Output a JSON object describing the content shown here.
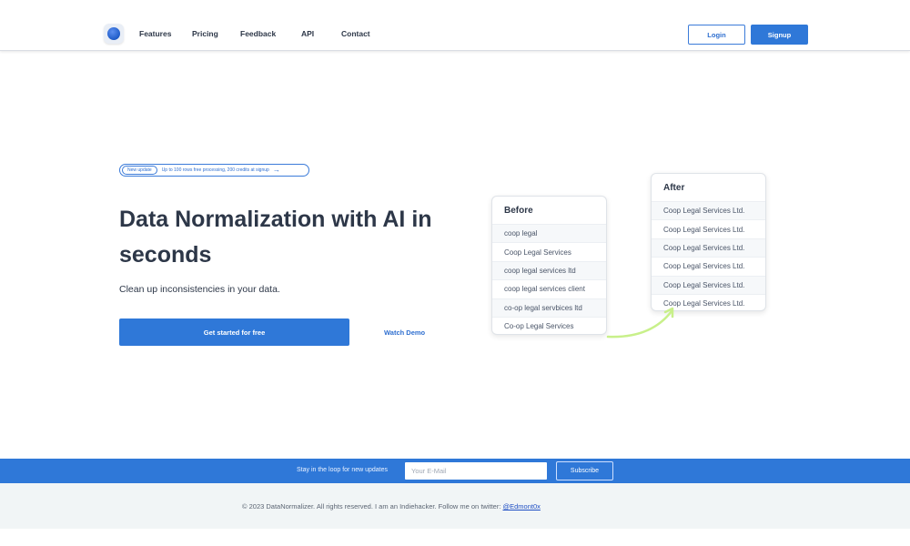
{
  "nav": {
    "links": [
      "Features",
      "Pricing",
      "Feedback",
      "API",
      "Contact"
    ],
    "login_label": "Login",
    "signup_label": "Signup"
  },
  "hero": {
    "badge_label": "New update",
    "badge_text": "Up to 100 rows free processing, 200 credits at signup",
    "badge_arrow": "→",
    "title": "Data Normalization with AI in seconds",
    "subtitle": "Clean up inconsistencies in your data.",
    "cta_label": "Get started for free",
    "demo_label": "Watch Demo"
  },
  "before_card": {
    "title": "Before",
    "rows": [
      "coop legal",
      "Coop Legal Services",
      "coop legal services ltd",
      "coop legal services client",
      "co-op legal servbices ltd",
      "Co-op Legal Services"
    ]
  },
  "after_card": {
    "title": "After",
    "rows": [
      "Coop Legal Services Ltd.",
      "Coop Legal Services Ltd.",
      "Coop Legal Services Ltd.",
      "Coop Legal Services Ltd.",
      "Coop Legal Services Ltd.",
      "Coop Legal Services Ltd."
    ]
  },
  "newsletter": {
    "text": "Stay in the loop for new updates",
    "placeholder": "Your E-Mail",
    "button_label": "Subscribe"
  },
  "footer": {
    "text": "© 2023 DataNormalizer. All rights reserved. I am an Indiehacker. Follow me on twitter: ",
    "link_label": "@Edmont0x"
  },
  "colors": {
    "primary": "#2f78d8",
    "text": "#2d3748",
    "footer_bg": "#f1f5f6",
    "curve": "#c8f08a"
  },
  "icons": {
    "logo": "blue-orb-logo-icon",
    "pill_arrow": "arrow-right-icon",
    "curve": "curved-arrow-icon"
  }
}
